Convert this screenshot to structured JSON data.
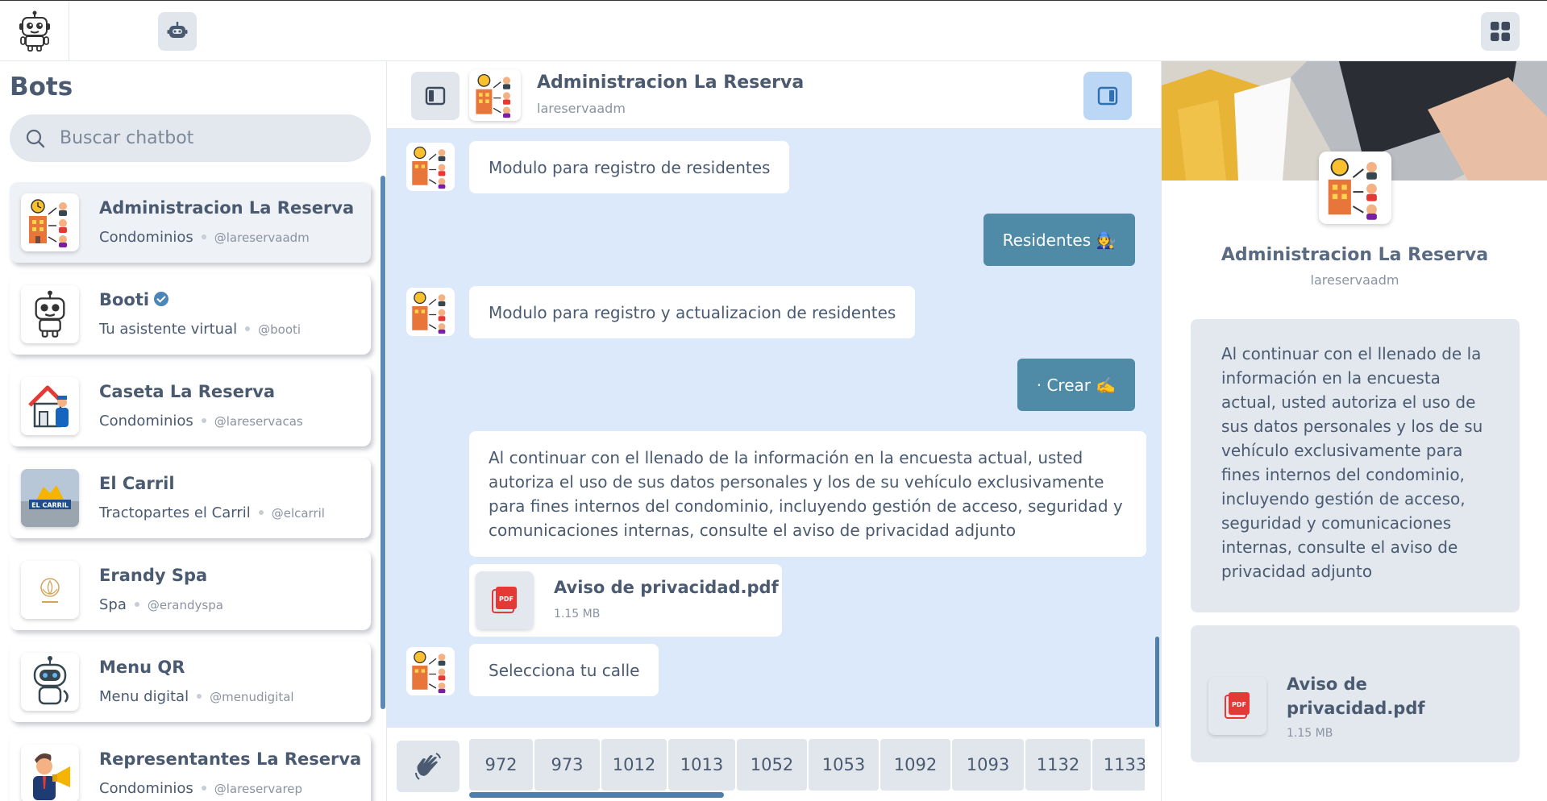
{
  "topbar": {
    "logo_icon": "robot-logo-icon",
    "chat_icon": "chat-bubble-icon",
    "bots_icon": "bot-face-icon",
    "grid_icon": "grid-icon"
  },
  "sidebar": {
    "title": "Bots",
    "search_placeholder": "Buscar chatbot",
    "bots": [
      {
        "name": "Administracion La Reserva",
        "category": "Condominios",
        "handle": "@lareservaadm",
        "verified": false,
        "active": true
      },
      {
        "name": "Booti",
        "category": "Tu asistente virtual",
        "handle": "@booti",
        "verified": true,
        "active": false
      },
      {
        "name": "Caseta La Reserva",
        "category": "Condominios",
        "handle": "@lareservacas",
        "verified": false,
        "active": false
      },
      {
        "name": "El Carril",
        "category": "Tractopartes el Carril",
        "handle": "@elcarril",
        "verified": false,
        "active": false
      },
      {
        "name": "Erandy Spa",
        "category": "Spa",
        "handle": "@erandyspa",
        "verified": false,
        "active": false
      },
      {
        "name": "Menu QR",
        "category": "Menu digital",
        "handle": "@menudigital",
        "verified": false,
        "active": false
      },
      {
        "name": "Representantes La Reserva",
        "category": "Condominios",
        "handle": "@lareservarep",
        "verified": false,
        "active": false
      }
    ],
    "logo_text_el_carril": "EL CARRIL"
  },
  "chat": {
    "header": {
      "name": "Administracion La Reserva",
      "handle": "lareservaadm"
    },
    "messages": {
      "m1": "Modulo para registro de residentes",
      "m2": "Residentes 🧑‍🔧",
      "m3": "Modulo para registro y actualizacion de residentes",
      "m4": "· Crear ✍️",
      "m5": "Al continuar con el llenado de la información en la encuesta actual, usted autoriza el uso de sus datos personales y los de su vehículo exclusivamente para fines internos del condominio, incluyendo gestión de acceso, seguridad y comunicaciones internas, consulte el aviso de privacidad adjunto",
      "m7": "Selecciona tu calle"
    },
    "file": {
      "name": "Aviso de privacidad.pdf",
      "size": "1.15 MB",
      "badge": "PDF"
    },
    "options": [
      "972",
      "973",
      "1012",
      "1013",
      "1052",
      "1053",
      "1092",
      "1093",
      "1132",
      "1133"
    ]
  },
  "panel": {
    "name": "Administracion La Reserva",
    "handle": "lareservaadm",
    "text": "Al continuar con el llenado de la información en la encuesta actual, usted autoriza el uso de sus datos personales y los de su vehículo exclusivamente para fines internos del condominio, incluyendo gestión de acceso, seguridad y comunicaciones internas, consulte el aviso de privacidad adjunto",
    "file_name": "Aviso de privacidad.pdf",
    "file_size": "1.15 MB",
    "badge": "PDF"
  },
  "colors": {
    "accent": "#4f8aa7",
    "chat_bg": "#dce9fa",
    "active_btn": "#bcd6f5",
    "pdf_red": "#e53935"
  }
}
